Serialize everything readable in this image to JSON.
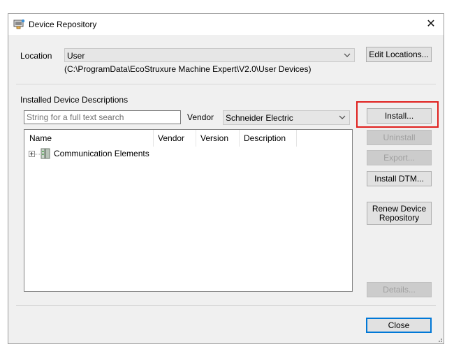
{
  "window": {
    "title": "Device Repository",
    "icon": "device-repository-icon"
  },
  "location": {
    "label": "Location",
    "value": "User",
    "path": "(C:\\ProgramData\\EcoStruxure Machine Expert\\V2.0\\User Devices)",
    "edit_button": "Edit Locations..."
  },
  "installed": {
    "section_label": "Installed Device Descriptions",
    "search_placeholder": "String for a full text search",
    "vendor_label": "Vendor",
    "vendor_value": "Schneider Electric",
    "columns": [
      "Name",
      "Vendor",
      "Version",
      "Description"
    ],
    "tree": [
      {
        "label": "Communication Elements",
        "icon": "communication-elements-icon",
        "expander": "plus-expander"
      }
    ]
  },
  "buttons": {
    "install": "Install...",
    "uninstall": "Uninstall",
    "export": "Export...",
    "install_dtm": "Install DTM...",
    "renew_line1": "Renew Device",
    "renew_line2": "Repository",
    "details": "Details...",
    "close": "Close"
  },
  "colors": {
    "highlight": "#e0201e",
    "default_button_border": "#0078d7"
  }
}
